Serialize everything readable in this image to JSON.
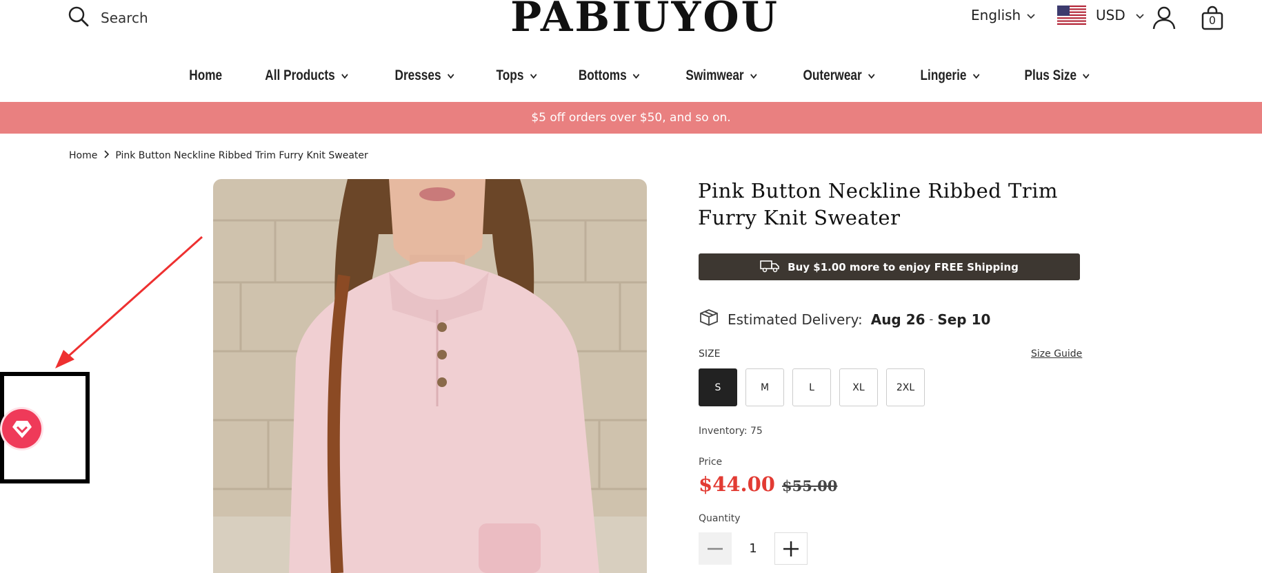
{
  "header": {
    "search_label": "Search",
    "logo_text": "PABIUYOU",
    "language": "English",
    "currency": "USD",
    "cart_count": "0"
  },
  "nav": [
    {
      "label": "Home",
      "has_dropdown": false
    },
    {
      "label": "All Products",
      "has_dropdown": true
    },
    {
      "label": "Dresses",
      "has_dropdown": true
    },
    {
      "label": "Tops",
      "has_dropdown": true
    },
    {
      "label": "Bottoms",
      "has_dropdown": true
    },
    {
      "label": "Swimwear",
      "has_dropdown": true
    },
    {
      "label": "Outerwear",
      "has_dropdown": true
    },
    {
      "label": "Lingerie",
      "has_dropdown": true
    },
    {
      "label": "Plus Size",
      "has_dropdown": true
    }
  ],
  "promo": "$5 off orders over $50, and so on.",
  "breadcrumb": {
    "home": "Home",
    "current": "Pink Button Neckline Ribbed Trim Furry Knit Sweater"
  },
  "product": {
    "title": "Pink Button Neckline Ribbed Trim Furry Knit Sweater",
    "shipping_banner": "Buy $1.00 more to enjoy FREE Shipping",
    "delivery_label": "Estimated Delivery",
    "delivery_sep": ":",
    "delivery_from": "Aug 26",
    "delivery_dash": "-",
    "delivery_to": "Sep 10",
    "size_label": "SIZE",
    "size_guide": "Size Guide",
    "sizes": [
      "S",
      "M",
      "L",
      "XL",
      "2XL"
    ],
    "selected_size": "S",
    "inventory": "Inventory: 75",
    "price_label": "Price",
    "price": "$44.00",
    "compare_price": "$55.00",
    "quantity_label": "Quantity",
    "quantity": "1"
  },
  "colors": {
    "promo_bg": "#e98080",
    "shipping_bg": "#3d3731",
    "price_red": "#e23b33",
    "badge": "#ef3a59"
  },
  "icons": [
    "search-icon",
    "chevron-down-icon",
    "us-flag-icon",
    "user-icon",
    "cart-bag-icon",
    "truck-icon",
    "package-icon",
    "diamond-heart-icon",
    "minus-icon",
    "plus-icon",
    "chevron-right-icon"
  ]
}
